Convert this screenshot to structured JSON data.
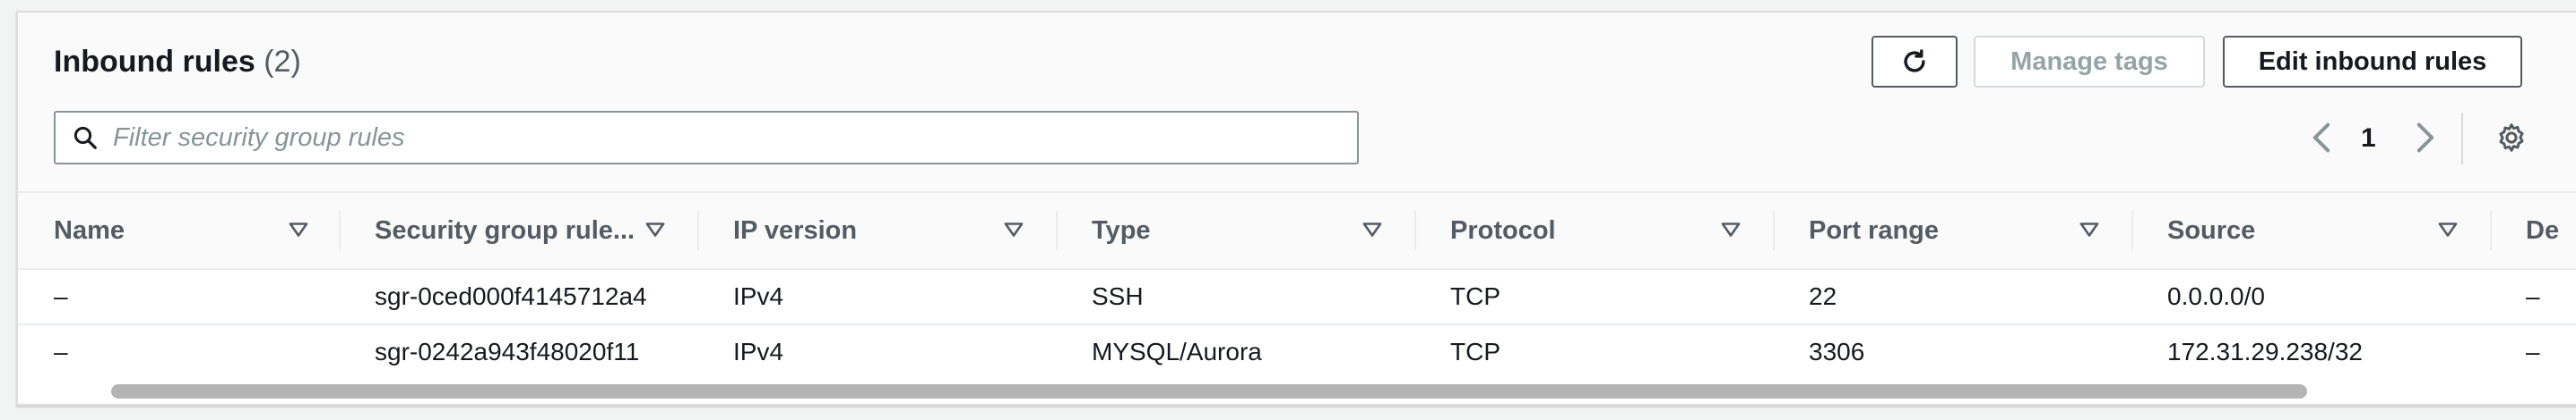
{
  "header": {
    "title": "Inbound rules",
    "count": "(2)"
  },
  "toolbar": {
    "refresh_icon": "refresh-icon",
    "manage_tags_label": "Manage tags",
    "edit_label": "Edit inbound rules"
  },
  "search": {
    "placeholder": "Filter security group rules",
    "value": ""
  },
  "pagination": {
    "current_page": "1"
  },
  "table": {
    "columns": [
      "Name",
      "Security group rule...",
      "IP version",
      "Type",
      "Protocol",
      "Port range",
      "Source",
      "De"
    ],
    "rows": [
      [
        "–",
        "sgr-0ced000f4145712a4",
        "IPv4",
        "SSH",
        "TCP",
        "22",
        "0.0.0.0/0",
        "–"
      ],
      [
        "–",
        "sgr-0242a943f48020f11",
        "IPv4",
        "MYSQL/Aurora",
        "TCP",
        "3306",
        "172.31.29.238/32",
        "–"
      ]
    ]
  },
  "colors": {
    "text": "#16191f",
    "muted": "#545b64",
    "disabled": "#95a5a6",
    "border": "#879596"
  }
}
